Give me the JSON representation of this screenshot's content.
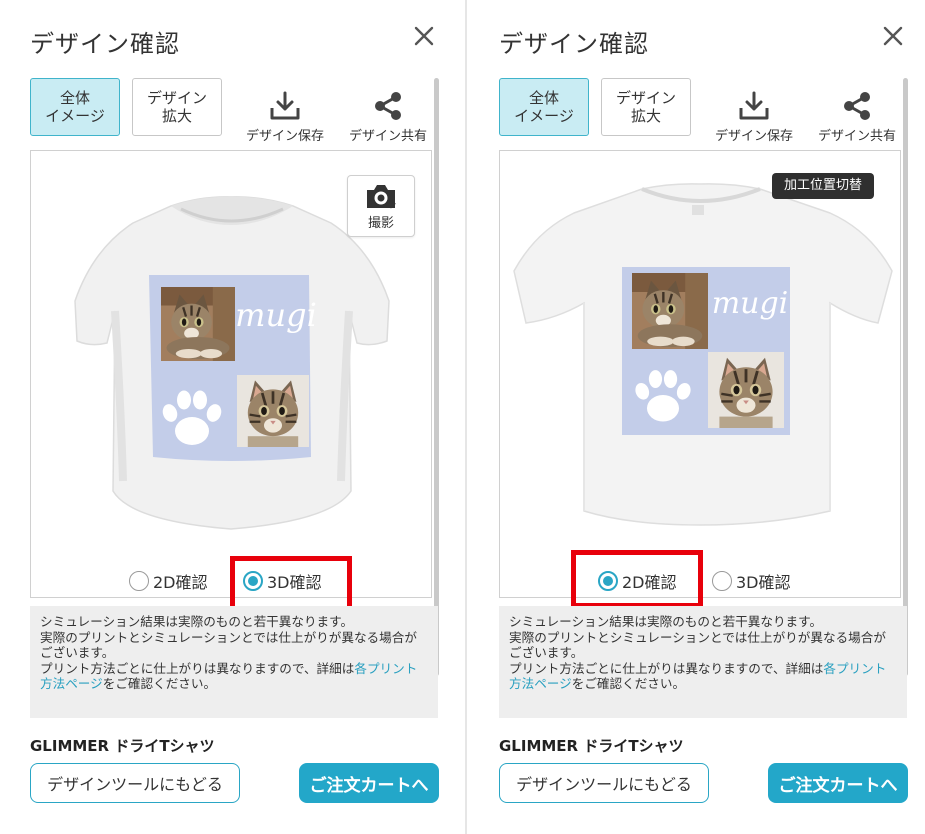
{
  "colors": {
    "accent": "#23a7c9",
    "active_tab_bg": "#c9ecf3",
    "highlight_red": "#e8000b",
    "design_panel": "#c3cde9",
    "notice_bg": "#eeeeee",
    "link": "#2aa0c0"
  },
  "panels": [
    {
      "title": "デザイン確認",
      "close_icon": "close-icon",
      "tabs": {
        "overview": "全体\nイメージ",
        "overview_active": true,
        "zoom": "デザイン\n拡大"
      },
      "tools": {
        "save_label": "デザイン保存",
        "save_icon": "download-icon",
        "share_label": "デザイン共有",
        "share_icon": "share-icon"
      },
      "preview": {
        "photo_button_label": "撮影",
        "photo_icon": "camera-icon",
        "design_text": "mugi"
      },
      "view_options": {
        "option_2d": "2D確認",
        "option_3d": "3D確認",
        "selected": "3D確認"
      },
      "notice": {
        "line1": "シミュレーション結果は実際のものと若干異なります。",
        "line2": "実際のプリントとシミュレーションとでは仕上がりが異なる場合がございます。",
        "line3_pre": "プリント方法ごとに仕上がりは異なりますので、詳細は",
        "line3_link": "各プリント方法ページ",
        "line3_post": "をご確認ください。"
      },
      "product_name": "GLIMMER ドライTシャツ",
      "back_button": "デザインツールにもどる",
      "cart_button": "ご注文カートへ"
    },
    {
      "title": "デザイン確認",
      "close_icon": "close-icon",
      "tabs": {
        "overview": "全体\nイメージ",
        "overview_active": true,
        "zoom": "デザイン\n拡大"
      },
      "tools": {
        "save_label": "デザイン保存",
        "save_icon": "download-icon",
        "share_label": "デザイン共有",
        "share_icon": "share-icon"
      },
      "preview": {
        "badge_label": "加工位置切替",
        "design_text": "mugi"
      },
      "view_options": {
        "option_2d": "2D確認",
        "option_3d": "3D確認",
        "selected": "2D確認"
      },
      "notice": {
        "line1": "シミュレーション結果は実際のものと若干異なります。",
        "line2": "実際のプリントとシミュレーションとでは仕上がりが異なる場合がございます。",
        "line3_pre": "プリント方法ごとに仕上がりは異なりますので、詳細は",
        "line3_link": "各プリント方法ページ",
        "line3_post": "をご確認ください。"
      },
      "product_name": "GLIMMER ドライTシャツ",
      "back_button": "デザインツールにもどる",
      "cart_button": "ご注文カートへ"
    }
  ]
}
